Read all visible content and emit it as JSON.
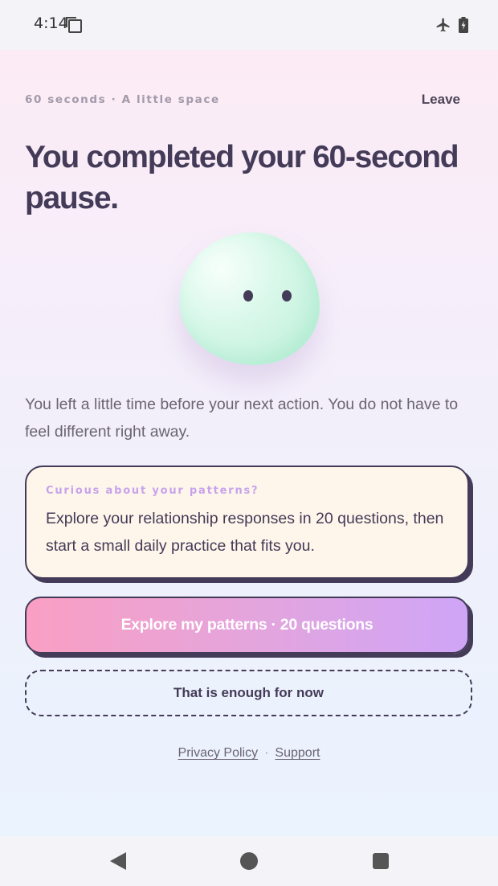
{
  "status_bar": {
    "time": "4:14",
    "icons": [
      "notification-icon",
      "airplane-mode-icon",
      "battery-charging-icon"
    ]
  },
  "header": {
    "subtitle": "60 seconds · A little space",
    "leave_label": "Leave"
  },
  "title": "You completed your 60-second pause.",
  "mascot": {
    "icon": "smiling-blob-mascot",
    "color": "#c9f4e0"
  },
  "description": "You left a little time before your next action. You do not have to feel different right away.",
  "card": {
    "eyebrow": "Curious about your patterns?",
    "body": "Explore your relationship responses in 20 questions, then start a small daily practice that fits you."
  },
  "buttons": {
    "primary_label": "Explore my patterns · 20 questions",
    "secondary_label": "That is enough for now"
  },
  "footer": {
    "privacy_label": "Privacy Policy",
    "separator": "·",
    "support_label": "Support"
  },
  "nav_bar": {
    "icons": [
      "back-icon",
      "home-icon",
      "recents-icon"
    ]
  },
  "colors": {
    "ink": "#433b58",
    "card_bg": "#fef6ea",
    "accent_pink": "#fa9fc3",
    "accent_purple": "#cfa5f7",
    "eyebrow": "#c7a3ec"
  }
}
